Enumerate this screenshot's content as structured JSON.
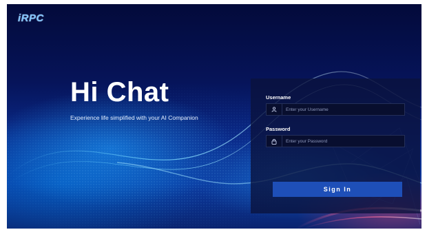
{
  "brand": {
    "logo_text": "iRPC"
  },
  "hero": {
    "title": "Hi Chat",
    "subtitle": "Experience life simplified with your AI Companion"
  },
  "login": {
    "username_label": "Username",
    "username_placeholder": "Enter your Username",
    "password_label": "Password",
    "password_placeholder": "Enter your Password",
    "signin_label": "Sign In"
  },
  "colors": {
    "background_dark": "#030a3a",
    "background_blue": "#0b3aa0",
    "panel": "#0a123c",
    "button": "#1e4fb8",
    "accent_pink": "#e6466e"
  },
  "icons": {
    "username": "user-icon",
    "password": "lock-icon"
  }
}
